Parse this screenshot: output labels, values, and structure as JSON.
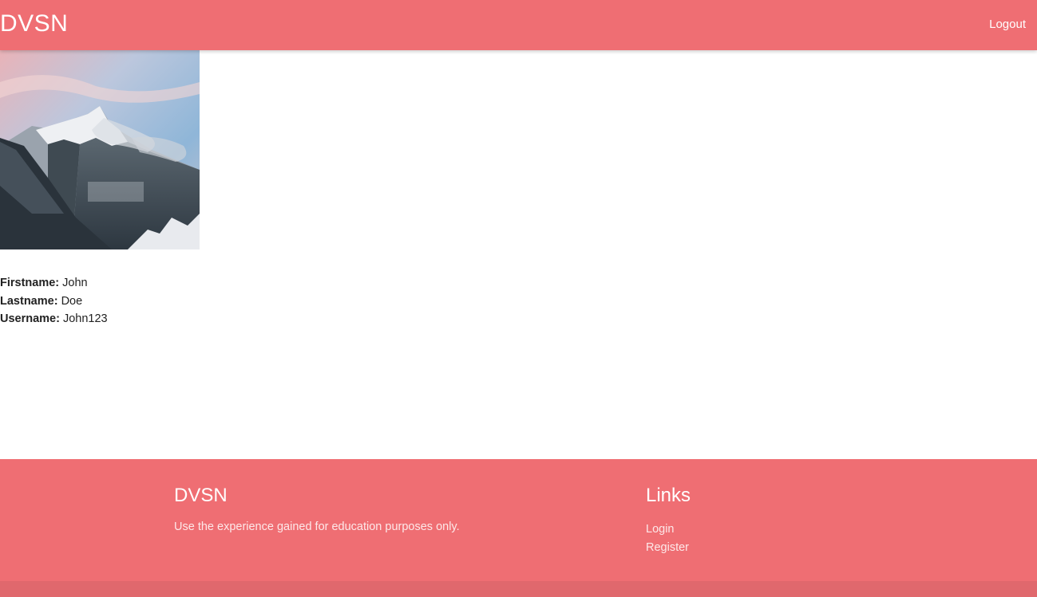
{
  "navbar": {
    "brand": "DVSN",
    "logout_label": "Logout",
    "color": "#ef6e73"
  },
  "profile": {
    "image_alt": "mountain-landscape",
    "fields": [
      {
        "label": "Firstname:",
        "value": "John"
      },
      {
        "label": "Lastname:",
        "value": "Doe"
      },
      {
        "label": "Username:",
        "value": "John123"
      }
    ]
  },
  "footer": {
    "brand_title": "DVSN",
    "tagline": "Use the experience gained for education purposes only.",
    "links_title": "Links",
    "links": [
      {
        "label": "Login"
      },
      {
        "label": "Register"
      }
    ]
  }
}
